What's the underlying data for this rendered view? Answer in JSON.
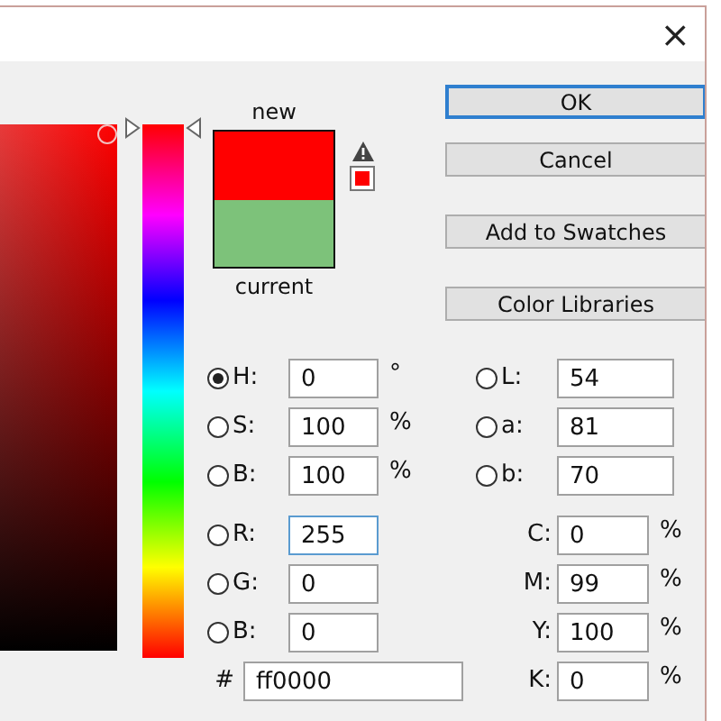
{
  "window": {
    "close": "×"
  },
  "hue_slider": {
    "level": 0
  },
  "swatch": {
    "parts": [
      {
        "label": "new",
        "color": "#ff0000"
      },
      {
        "label": "current",
        "color": "#7dc27a"
      }
    ],
    "gamut_warning": true
  },
  "buttons": [
    {
      "label": "OK",
      "default": true
    },
    {
      "label": "Cancel",
      "default": false
    },
    {
      "label": "Add to Swatches",
      "default": false
    },
    {
      "label": "Color Libraries",
      "default": false
    }
  ],
  "hsb": [
    {
      "label": "H:",
      "value": "0",
      "unit": "°",
      "selected": true,
      "focused": false
    },
    {
      "label": "S:",
      "value": "100",
      "unit": "%",
      "selected": false,
      "focused": false
    },
    {
      "label": "B:",
      "value": "100",
      "unit": "%",
      "selected": false,
      "focused": false
    }
  ],
  "lab": [
    {
      "label": "L:",
      "value": "54",
      "selected": false
    },
    {
      "label": "a:",
      "value": "81",
      "selected": false
    },
    {
      "label": "b:",
      "value": "70",
      "selected": false
    }
  ],
  "rgb": [
    {
      "label": "R:",
      "value": "255",
      "selected": false,
      "focused": true
    },
    {
      "label": "G:",
      "value": "0",
      "selected": false,
      "focused": false
    },
    {
      "label": "B:",
      "value": "0",
      "selected": false,
      "focused": false
    }
  ],
  "cmyk": [
    {
      "label": "C:",
      "value": "0",
      "unit": "%"
    },
    {
      "label": "M:",
      "value": "99",
      "unit": "%"
    },
    {
      "label": "Y:",
      "value": "100",
      "unit": "%"
    },
    {
      "label": "K:",
      "value": "0",
      "unit": "%"
    }
  ],
  "hex": {
    "label": "#",
    "value": "ff0000"
  }
}
